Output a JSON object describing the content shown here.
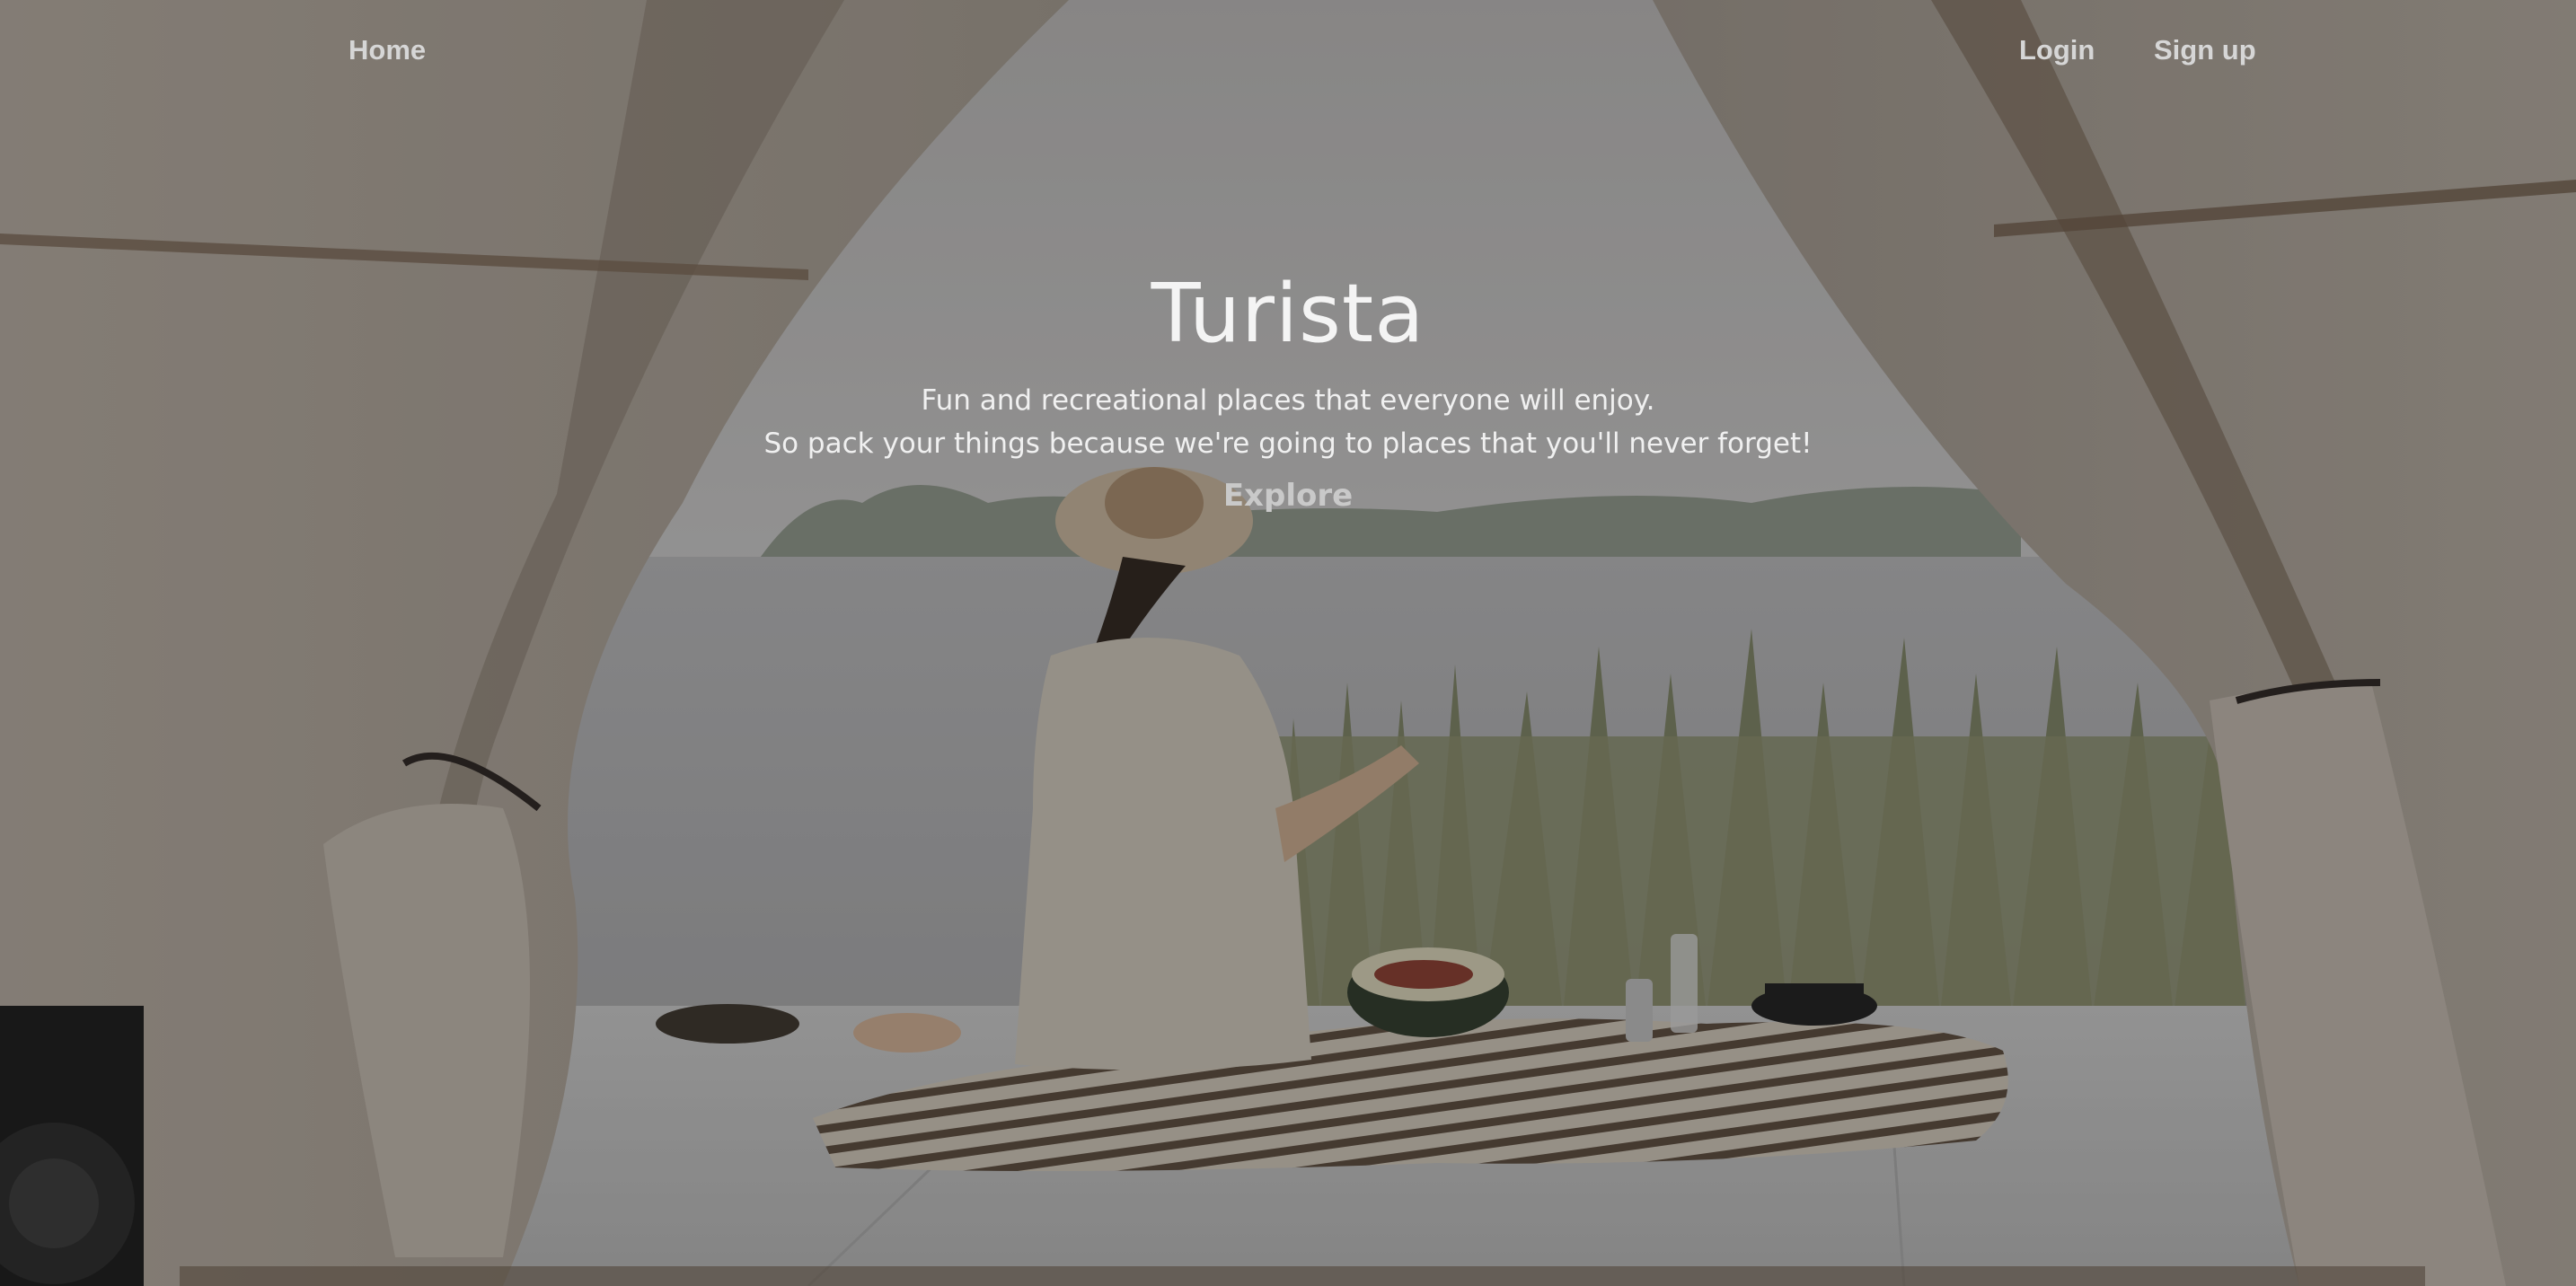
{
  "nav": {
    "home_label": "Home",
    "login_label": "Login",
    "signup_label": "Sign up"
  },
  "hero": {
    "title": "Turista",
    "subtitle_line1": "Fun and recreational places that everyone will enjoy.",
    "subtitle_line2": "So pack your things because we're going to places that you'll never forget!",
    "cta_label": "Explore"
  },
  "colors": {
    "overlay": "#000000",
    "text": "#f2f2f2",
    "link": "#d6d6d6"
  }
}
